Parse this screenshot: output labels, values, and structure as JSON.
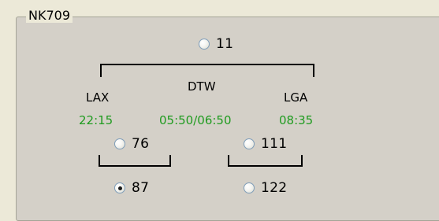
{
  "group": {
    "title": "NK709"
  },
  "top_option": {
    "label": "11",
    "checked": false
  },
  "route": {
    "origin": {
      "code": "LAX",
      "time": "22:15"
    },
    "connection": {
      "code": "DTW",
      "time": "05:50/06:50"
    },
    "destination": {
      "code": "LGA",
      "time": "08:35"
    }
  },
  "left_segment": {
    "option_a": {
      "label": "76",
      "checked": false
    },
    "option_b": {
      "label": "87",
      "checked": true
    }
  },
  "right_segment": {
    "option_a": {
      "label": "111",
      "checked": false
    },
    "option_b": {
      "label": "122",
      "checked": false
    }
  },
  "colors": {
    "time_text": "#1f9b1f"
  }
}
